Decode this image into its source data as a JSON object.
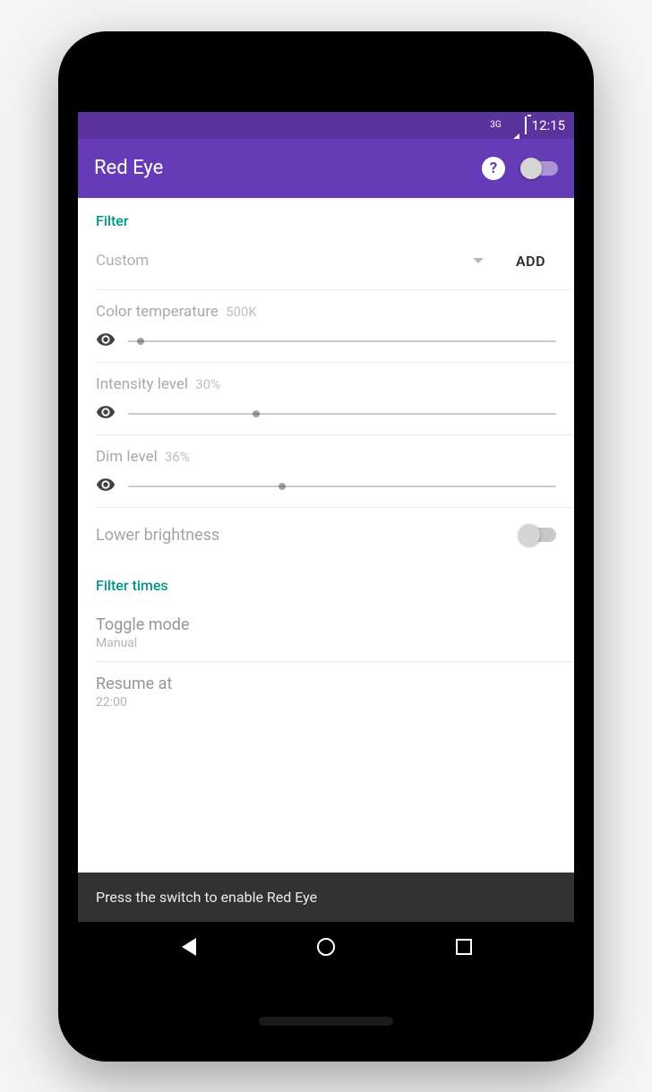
{
  "status": {
    "net_label": "3G",
    "time": "12:15"
  },
  "appbar": {
    "title": "Red Eye"
  },
  "filter": {
    "header": "Filter",
    "preset": "Custom",
    "add_label": "ADD",
    "color_temp": {
      "label": "Color temperature",
      "value": "500K",
      "percent": 3
    },
    "intensity": {
      "label": "Intensity level",
      "value": "30%",
      "percent": 30
    },
    "dim": {
      "label": "Dim level",
      "value": "36%",
      "percent": 36
    },
    "lower_brightness_label": "Lower brightness"
  },
  "times": {
    "header": "Filter times",
    "toggle_mode": {
      "label": "Toggle mode",
      "value": "Manual"
    },
    "resume": {
      "label": "Resume at",
      "value": "22:00"
    }
  },
  "snackbar": {
    "text": "Press the switch to enable Red Eye"
  }
}
